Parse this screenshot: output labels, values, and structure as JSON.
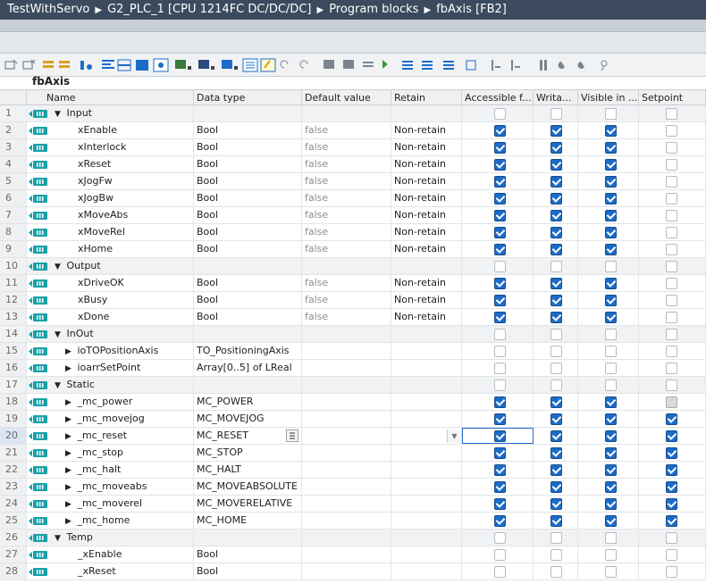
{
  "breadcrumb": [
    "TestWithServo",
    "G2_PLC_1 [CPU 1214FC DC/DC/DC]",
    "Program blocks",
    "fbAxis [FB2]"
  ],
  "block_name": "fbAxis",
  "columns": {
    "name": "Name",
    "data_type": "Data type",
    "default_value": "Default value",
    "retain": "Retain",
    "accessible": "Accessible f...",
    "writable": "Writa...",
    "visible": "Visible in ...",
    "setpoint": "Setpoint"
  },
  "rows": [
    {
      "n": "1",
      "name": "Input",
      "section": true,
      "type": "",
      "def": "",
      "ret": "",
      "acc": 0,
      "wri": 0,
      "vis": 0,
      "sp": 0
    },
    {
      "n": "2",
      "name": "xEnable",
      "type": "Bool",
      "def": "false",
      "ret": "Non-retain",
      "acc": 1,
      "wri": 1,
      "vis": 1,
      "sp": 0
    },
    {
      "n": "3",
      "name": "xInterlock",
      "type": "Bool",
      "def": "false",
      "ret": "Non-retain",
      "acc": 1,
      "wri": 1,
      "vis": 1,
      "sp": 0
    },
    {
      "n": "4",
      "name": "xReset",
      "type": "Bool",
      "def": "false",
      "ret": "Non-retain",
      "acc": 1,
      "wri": 1,
      "vis": 1,
      "sp": 0
    },
    {
      "n": "5",
      "name": "xJogFw",
      "type": "Bool",
      "def": "false",
      "ret": "Non-retain",
      "acc": 1,
      "wri": 1,
      "vis": 1,
      "sp": 0
    },
    {
      "n": "6",
      "name": "xJogBw",
      "type": "Bool",
      "def": "false",
      "ret": "Non-retain",
      "acc": 1,
      "wri": 1,
      "vis": 1,
      "sp": 0
    },
    {
      "n": "7",
      "name": "xMoveAbs",
      "type": "Bool",
      "def": "false",
      "ret": "Non-retain",
      "acc": 1,
      "wri": 1,
      "vis": 1,
      "sp": 0
    },
    {
      "n": "8",
      "name": "xMoveRel",
      "type": "Bool",
      "def": "false",
      "ret": "Non-retain",
      "acc": 1,
      "wri": 1,
      "vis": 1,
      "sp": 0
    },
    {
      "n": "9",
      "name": "xHome",
      "type": "Bool",
      "def": "false",
      "ret": "Non-retain",
      "acc": 1,
      "wri": 1,
      "vis": 1,
      "sp": 0
    },
    {
      "n": "10",
      "name": "Output",
      "section": true,
      "type": "",
      "def": "",
      "ret": "",
      "acc": 0,
      "wri": 0,
      "vis": 0,
      "sp": 0
    },
    {
      "n": "11",
      "name": "xDriveOK",
      "type": "Bool",
      "def": "false",
      "ret": "Non-retain",
      "acc": 1,
      "wri": 1,
      "vis": 1,
      "sp": 0
    },
    {
      "n": "12",
      "name": "xBusy",
      "type": "Bool",
      "def": "false",
      "ret": "Non-retain",
      "acc": 1,
      "wri": 1,
      "vis": 1,
      "sp": 0
    },
    {
      "n": "13",
      "name": "xDone",
      "type": "Bool",
      "def": "false",
      "ret": "Non-retain",
      "acc": 1,
      "wri": 1,
      "vis": 1,
      "sp": 0
    },
    {
      "n": "14",
      "name": "InOut",
      "section": true,
      "type": "",
      "def": "",
      "ret": "",
      "acc": 0,
      "wri": 0,
      "vis": 0,
      "sp": 0
    },
    {
      "n": "15",
      "name": "ioTOPositionAxis",
      "sub": true,
      "type": "TO_PositioningAxis",
      "def": "",
      "ret": "",
      "acc": 0,
      "wri": 0,
      "vis": 0,
      "sp": 0
    },
    {
      "n": "16",
      "name": "ioarrSetPoint",
      "sub": true,
      "type": "Array[0..5] of LReal",
      "def": "",
      "ret": "",
      "acc": 0,
      "wri": 0,
      "vis": 0,
      "sp": 0
    },
    {
      "n": "17",
      "name": "Static",
      "section": true,
      "type": "",
      "def": "",
      "ret": "",
      "acc": 0,
      "wri": 0,
      "vis": 0,
      "sp": 0
    },
    {
      "n": "18",
      "name": "_mc_power",
      "sub": true,
      "type": "MC_POWER",
      "def": "",
      "ret": "",
      "acc": 1,
      "wri": 1,
      "vis": 1,
      "sp": 2
    },
    {
      "n": "19",
      "name": "_mc_movejog",
      "sub": true,
      "type": "MC_MOVEJOG",
      "def": "",
      "ret": "",
      "acc": 1,
      "wri": 1,
      "vis": 1,
      "sp": 1
    },
    {
      "n": "20",
      "name": "_mc_reset",
      "sub": true,
      "type": "MC_RESET",
      "def": "",
      "ret": "",
      "acc": 1,
      "wri": 1,
      "vis": 1,
      "sp": 1,
      "active": true
    },
    {
      "n": "21",
      "name": "_mc_stop",
      "sub": true,
      "type": "MC_STOP",
      "def": "",
      "ret": "",
      "acc": 1,
      "wri": 1,
      "vis": 1,
      "sp": 1
    },
    {
      "n": "22",
      "name": "_mc_halt",
      "sub": true,
      "type": "MC_HALT",
      "def": "",
      "ret": "",
      "acc": 1,
      "wri": 1,
      "vis": 1,
      "sp": 1
    },
    {
      "n": "23",
      "name": "_mc_moveabs",
      "sub": true,
      "type": "MC_MOVEABSOLUTE",
      "def": "",
      "ret": "",
      "acc": 1,
      "wri": 1,
      "vis": 1,
      "sp": 1
    },
    {
      "n": "24",
      "name": "_mc_moverel",
      "sub": true,
      "type": "MC_MOVERELATIVE",
      "def": "",
      "ret": "",
      "acc": 1,
      "wri": 1,
      "vis": 1,
      "sp": 1
    },
    {
      "n": "25",
      "name": "_mc_home",
      "sub": true,
      "type": "MC_HOME",
      "def": "",
      "ret": "",
      "acc": 1,
      "wri": 1,
      "vis": 1,
      "sp": 1
    },
    {
      "n": "26",
      "name": "Temp",
      "section": true,
      "type": "",
      "def": "",
      "ret": "",
      "acc": 0,
      "wri": 0,
      "vis": 0,
      "sp": 0
    },
    {
      "n": "27",
      "name": "_xEnable",
      "type": "Bool",
      "def": "",
      "ret": "",
      "acc": 0,
      "wri": 0,
      "vis": 0,
      "sp": 0
    },
    {
      "n": "28",
      "name": "_xReset",
      "type": "Bool",
      "def": "",
      "ret": "",
      "acc": 0,
      "wri": 0,
      "vis": 0,
      "sp": 0
    }
  ],
  "colors": {
    "title_bg": "#3b4a5c",
    "check_on": "#1b6cc9",
    "icon_teal": "#19a0a8"
  }
}
